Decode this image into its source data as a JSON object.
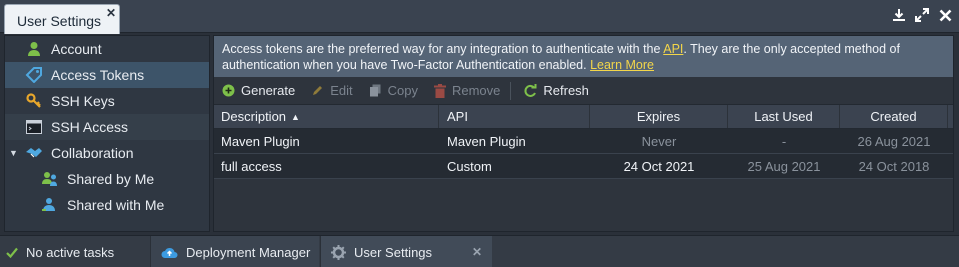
{
  "window": {
    "tab_title": "User Settings",
    "close_glyph": "✕"
  },
  "sidebar": {
    "items": [
      {
        "label": "Account",
        "icon": "user-icon"
      },
      {
        "label": "Access Tokens",
        "icon": "tag-icon"
      },
      {
        "label": "SSH Keys",
        "icon": "key-icon"
      },
      {
        "label": "SSH Access",
        "icon": "terminal-icon"
      },
      {
        "label": "Collaboration",
        "icon": "handshake-icon"
      },
      {
        "label": "Shared by Me",
        "icon": "users-icon"
      },
      {
        "label": "Shared with Me",
        "icon": "user-share-icon"
      }
    ]
  },
  "info": {
    "text1": "Access tokens are the preferred way for any integration to authenticate with the ",
    "api_link": "API",
    "text2": ". They are the only accepted method of authentication when you have Two-Factor Authentication enabled. ",
    "learn_more": "Learn More"
  },
  "toolbar": {
    "generate": "Generate",
    "edit": "Edit",
    "copy": "Copy",
    "remove": "Remove",
    "refresh": "Refresh"
  },
  "table": {
    "headers": {
      "description": "Description",
      "api": "API",
      "expires": "Expires",
      "last_used": "Last Used",
      "created": "Created"
    },
    "sort_glyph": "▲",
    "rows": [
      {
        "description": "Maven Plugin",
        "api": "Maven Plugin",
        "expires": "Never",
        "last_used": "-",
        "created": "26 Aug 2021"
      },
      {
        "description": "full access",
        "api": "Custom",
        "expires": "24 Oct 2021",
        "last_used": "25 Aug 2021",
        "created": "24 Oct 2018"
      }
    ]
  },
  "statusbar": {
    "tasks": "No active tasks",
    "deployment_manager": "Deployment Manager",
    "user_settings": "User Settings",
    "close_glyph": "✕"
  },
  "colors": {
    "accent_green": "#7ec04a",
    "link_yellow": "#f3d64a",
    "selection_blue": "#3d5469"
  }
}
